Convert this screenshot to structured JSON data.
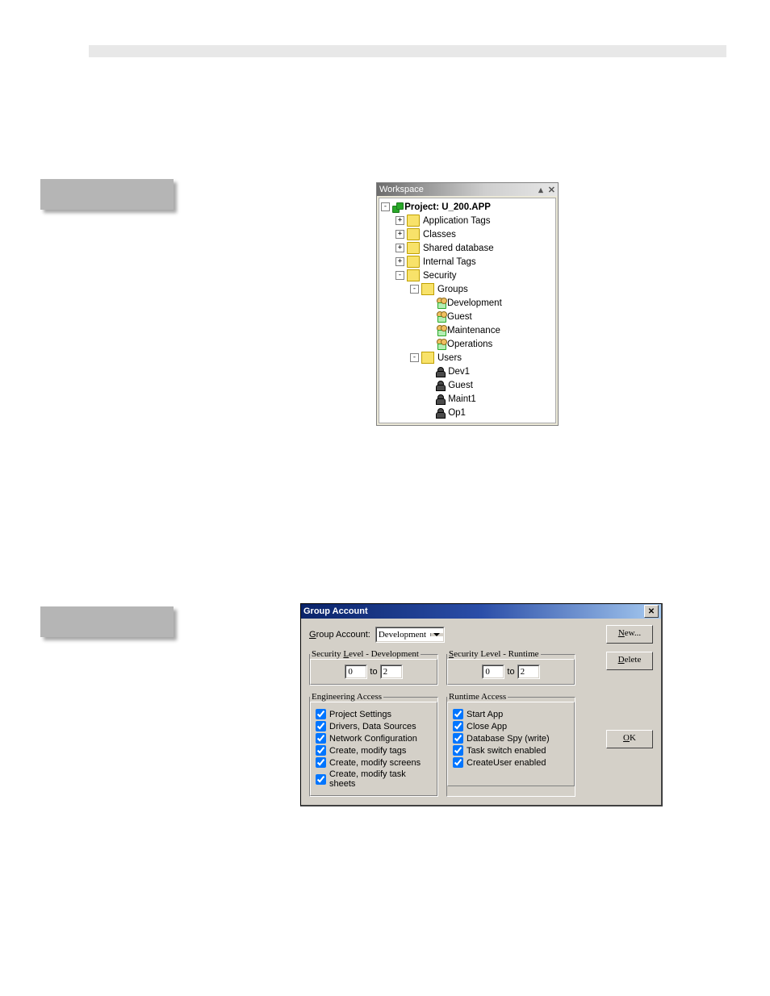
{
  "workspace": {
    "title": "Workspace",
    "project_label": "Project: U_200.APP",
    "items": [
      "Application Tags",
      "Classes",
      "Shared database",
      "Internal Tags",
      "Security"
    ],
    "groups_label": "Groups",
    "groups": [
      "Development",
      "Guest",
      "Maintenance",
      "Operations"
    ],
    "users_label": "Users",
    "users": [
      "Dev1",
      "Guest",
      "Maint1",
      "Op1"
    ]
  },
  "dialog": {
    "title": "Group Account",
    "group_account_label": "Group Account:",
    "group_account_value": "Development",
    "new_btn": "New...",
    "delete_btn": "Delete",
    "ok_btn": "OK",
    "sec_dev_legend": "Security Level - Development",
    "sec_run_legend": "Security Level - Runtime",
    "range_to": "to",
    "dev_from": "0",
    "dev_to": "2",
    "run_from": "0",
    "run_to": "2",
    "eng_legend": "Engineering Access",
    "eng_items": [
      "Project Settings",
      "Drivers, Data Sources",
      "Network Configuration",
      "Create, modify tags",
      "Create, modify screens",
      "Create, modify task sheets"
    ],
    "run_legend": "Runtime Access",
    "run_items": [
      "Start App",
      "Close App",
      "Database Spy (write)",
      "Task switch enabled",
      "CreateUser enabled"
    ]
  }
}
